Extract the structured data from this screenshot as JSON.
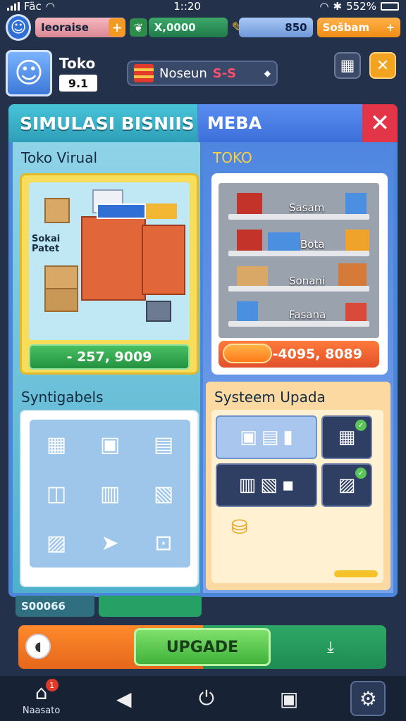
{
  "status": {
    "carrier": "Fäc",
    "time": "1::20",
    "battery": "552%"
  },
  "resources": {
    "pink_label": "Ieoraise",
    "plus": "+",
    "green_value": "X,0000",
    "blue_value": "850",
    "orange_label": "Sošbam",
    "orange_plus": "+"
  },
  "profile": {
    "name": "Toko",
    "level": "9.1",
    "shop_chip": "Noseun",
    "shop_chip_red": "S-S"
  },
  "tabs": {
    "left": "SIMULASI BISNIIS",
    "right": "MEBA"
  },
  "left_column": {
    "title": "Toko Virual",
    "scene_label": "Sokai\nPatet",
    "price": "- 257, 9009",
    "systems_title": "Syntigabels"
  },
  "right_column": {
    "title": "TOKO",
    "shelf_labels": [
      "Sasam",
      "Bota",
      "Sonani",
      "Fasana"
    ],
    "price": "-4095, 8089",
    "systems_title": "Systeem Upada"
  },
  "bottom": {
    "small_label": "S00066",
    "upgrade_label": "UPGADE"
  },
  "nav": {
    "home_label": "Naasato",
    "home_badge": "1"
  }
}
